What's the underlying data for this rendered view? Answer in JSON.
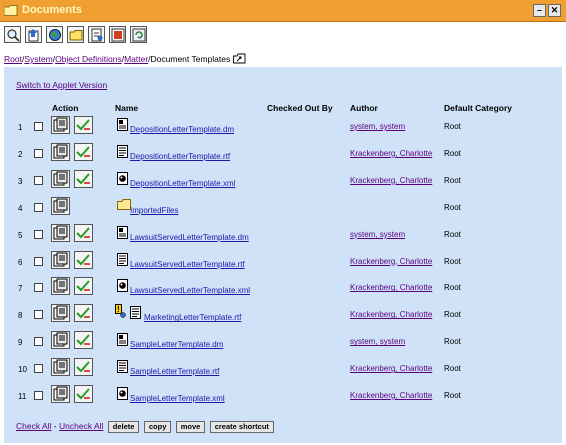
{
  "window": {
    "title": "Documents",
    "minimize_label": "–",
    "close_label": "✕"
  },
  "toolbar": [
    {
      "icon": "search-icon"
    },
    {
      "icon": "upload-icon"
    },
    {
      "icon": "globe-icon"
    },
    {
      "icon": "new-folder-icon"
    },
    {
      "icon": "new-document-icon"
    },
    {
      "icon": "report-icon"
    },
    {
      "icon": "refresh-icon"
    }
  ],
  "breadcrumb": {
    "root": "Root",
    "sep1": "/",
    "system": "System",
    "sep2": "/",
    "object_definitions": "Object Definitions",
    "sep3": "/",
    "matter": "Matter",
    "sep4": "/",
    "current": "Document Templates"
  },
  "applet_link": "Switch to Applet Version",
  "columns": {
    "action": "Action",
    "name": "Name",
    "checked_out_by": "Checked Out By",
    "author": "Author",
    "default_category": "Default Category"
  },
  "rows": [
    {
      "num": "1",
      "name": "DepositionLetterTemplate.dm",
      "icon": "dm-file-icon",
      "author": "system, system",
      "category": "Root",
      "actions": 2,
      "warn": false
    },
    {
      "num": "2",
      "name": "DepositionLetterTemplate.rtf",
      "icon": "rtf-file-icon",
      "author": "Krackenberg, Charlotte",
      "category": "Root",
      "actions": 2,
      "warn": false
    },
    {
      "num": "3",
      "name": "DepositionLetterTemplate.xml",
      "icon": "xml-file-icon",
      "author": "Krackenberg, Charlotte",
      "category": "Root",
      "actions": 2,
      "warn": false
    },
    {
      "num": "4",
      "name": "ImportedFiles",
      "icon": "folder-icon",
      "author": "",
      "category": "Root",
      "actions": 1,
      "warn": false
    },
    {
      "num": "5",
      "name": "LawsuitServedLetterTemplate.dm",
      "icon": "dm-file-icon",
      "author": "system, system",
      "category": "Root",
      "actions": 2,
      "warn": false
    },
    {
      "num": "6",
      "name": "LawsuitServedLetterTemplate.rtf",
      "icon": "rtf-file-icon",
      "author": "Krackenberg, Charlotte",
      "category": "Root",
      "actions": 2,
      "warn": false
    },
    {
      "num": "7",
      "name": "LawsuitServedLetterTemplate.xml",
      "icon": "xml-file-icon",
      "author": "Krackenberg, Charlotte",
      "category": "Root",
      "actions": 2,
      "warn": false
    },
    {
      "num": "8",
      "name": "MarketingLetterTemplate.rtf",
      "icon": "rtf-file-icon",
      "author": "Krackenberg, Charlotte",
      "category": "Root",
      "actions": 2,
      "warn": true
    },
    {
      "num": "9",
      "name": "SampleLetterTemplate.dm",
      "icon": "dm-file-icon",
      "author": "system, system",
      "category": "Root",
      "actions": 2,
      "warn": false
    },
    {
      "num": "10",
      "name": "SampleLetterTemplate.rtf",
      "icon": "rtf-file-icon",
      "author": "Krackenberg, Charlotte",
      "category": "Root",
      "actions": 2,
      "warn": false
    },
    {
      "num": "11",
      "name": "SampleLetterTemplate.xml",
      "icon": "xml-file-icon",
      "author": "Krackenberg, Charlotte",
      "category": "Root",
      "actions": 2,
      "warn": false
    }
  ],
  "footer": {
    "check_all": "Check All",
    "dash": " - ",
    "uncheck_all": "Uncheck All",
    "delete": "delete",
    "copy": "copy",
    "move": "move",
    "create_shortcut": "create shortcut"
  },
  "colors": {
    "title_bar": "#f0a030",
    "panel": "#cfe2f7",
    "link": "#5a0080",
    "file_link": "#1a1aaa"
  }
}
